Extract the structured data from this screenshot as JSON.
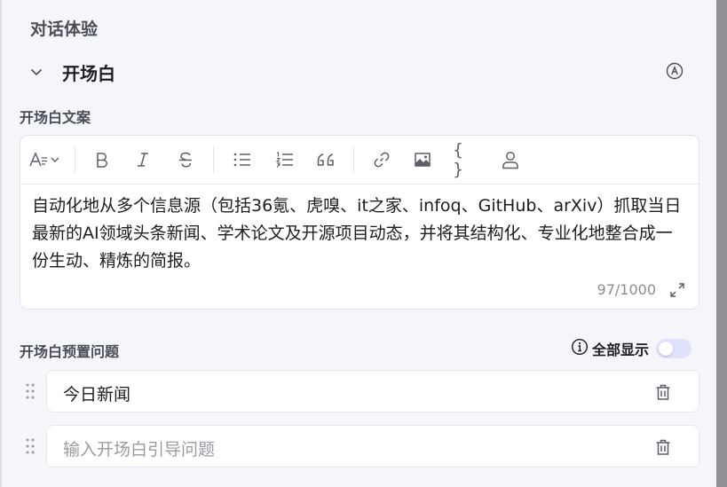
{
  "section": {
    "title": "对话体验"
  },
  "opening": {
    "title": "开场白",
    "copy_label": "开场白文案",
    "text": "自动化地从多个信息源（包括36氪、虎嗅、it之家、infoq、GitHub、arXiv）抓取当日最新的AI领域头条新闻、学术论文及开源项目动态，并将其结构化、专业化地整合成一份生动、精炼的简报。",
    "counter": "97/1000"
  },
  "toolbar": {
    "code_glyph": "{ }"
  },
  "preset": {
    "label": "开场白预置问题",
    "show_all_label": "全部显示",
    "show_all_on": false,
    "items": [
      {
        "text": "今日新闻"
      }
    ],
    "new_placeholder": "输入开场白引导问题"
  },
  "colors": {
    "accent": "#4d5cf0",
    "toggle_off": "#dfe2fb"
  }
}
